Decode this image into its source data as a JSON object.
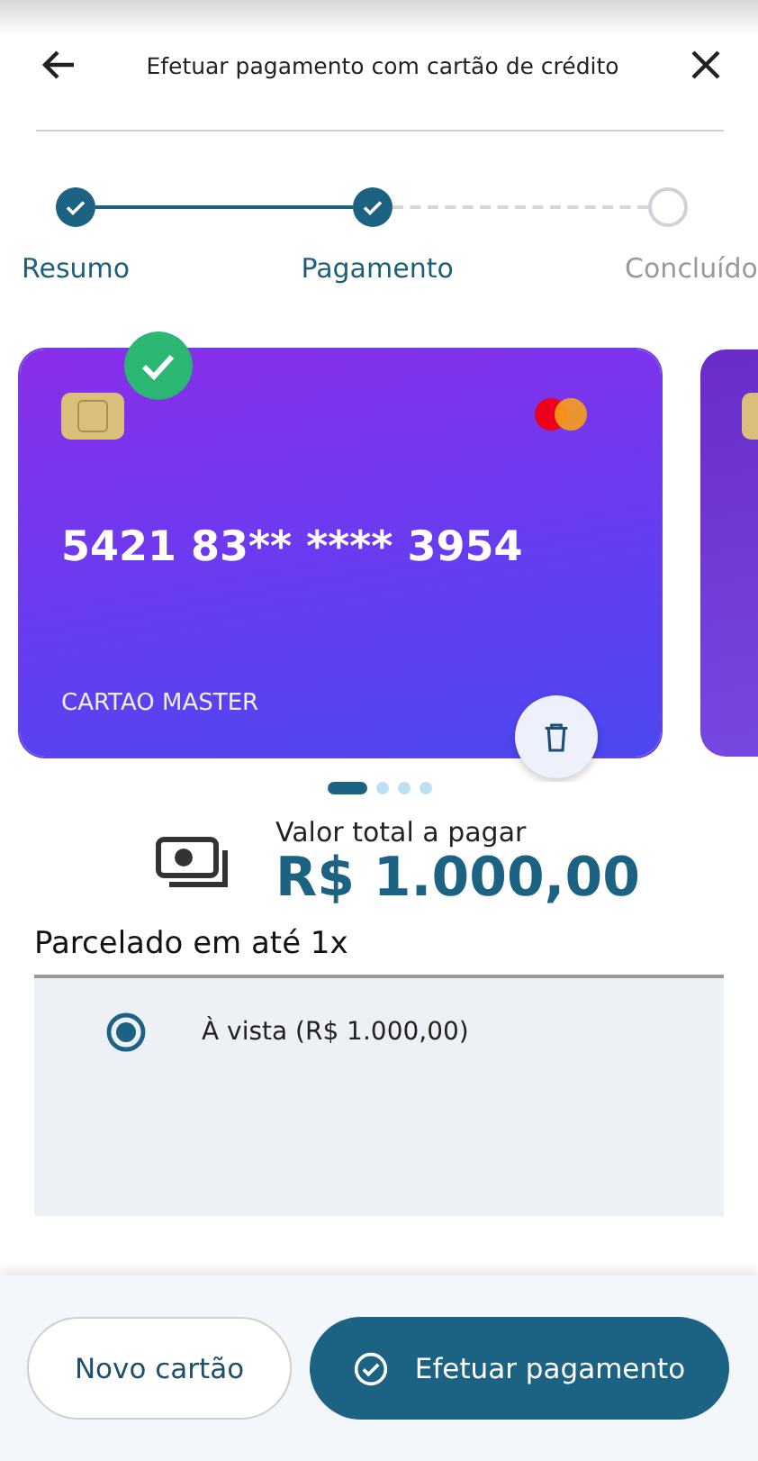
{
  "header": {
    "title": "Efetuar pagamento com cartão de crédito"
  },
  "steps": [
    {
      "label": "Resumo",
      "completed": true
    },
    {
      "label": "Pagamento",
      "completed": true
    },
    {
      "label": "Concluído",
      "completed": false
    }
  ],
  "cards": [
    {
      "number": "5421 83** **** 3954",
      "name": "CARTAO MASTER",
      "selected": true
    }
  ],
  "pager": [
    {
      "selected": true
    },
    {
      "selected": false
    },
    {
      "selected": false
    },
    {
      "selected": false
    }
  ],
  "total": {
    "label": "Valor total a pagar",
    "amount": "R$ 1.000,00"
  },
  "installments": {
    "title": "Parcelado em até 1x",
    "options": [
      {
        "label": "À vista (R$ 1.000,00)",
        "selected": true
      }
    ]
  },
  "buttons": {
    "secondary": "Novo cartão",
    "primary": "Efetuar pagamento"
  }
}
